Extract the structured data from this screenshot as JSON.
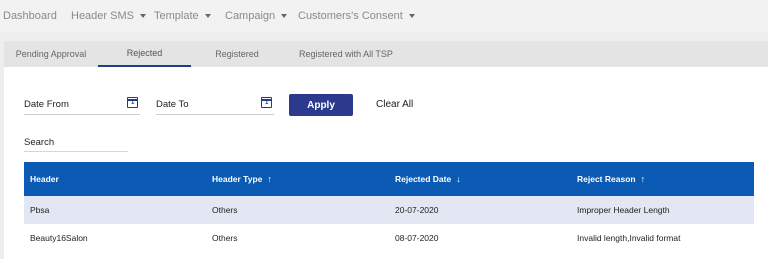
{
  "nav": {
    "items": [
      {
        "label": "Dashboard"
      },
      {
        "label": "Header SMS"
      },
      {
        "label": "Template"
      },
      {
        "label": "Campaign"
      },
      {
        "label": "Customers's Consent"
      }
    ]
  },
  "tabs": [
    {
      "label": "Pending Approval"
    },
    {
      "label": "Rejected"
    },
    {
      "label": "Registered"
    },
    {
      "label": "Registered with All TSP"
    }
  ],
  "filters": {
    "date_from": "Date From",
    "date_to": "Date To",
    "apply": "Apply",
    "clear": "Clear All",
    "search": "Search"
  },
  "table": {
    "columns": [
      {
        "label": "Header",
        "sort": ""
      },
      {
        "label": "Header Type",
        "sort": "↑"
      },
      {
        "label": "Rejected Date",
        "sort": "↓"
      },
      {
        "label": "Reject Reason",
        "sort": "↑"
      }
    ],
    "rows": [
      {
        "header": "Pbsa",
        "type": "Others",
        "date": "20-07-2020",
        "reason": "Improper Header Length"
      },
      {
        "header": "Beauty16Salon",
        "type": "Others",
        "date": "08-07-2020",
        "reason": "Invalid length,Invalid format"
      }
    ]
  },
  "colors": {
    "accent": "#2b3a8c",
    "table_header": "#0b5ab3",
    "row_alt": "#e3e7f3"
  },
  "icons": {
    "calendar": "calendar-icon",
    "dropdown": "chevron-down-icon"
  }
}
